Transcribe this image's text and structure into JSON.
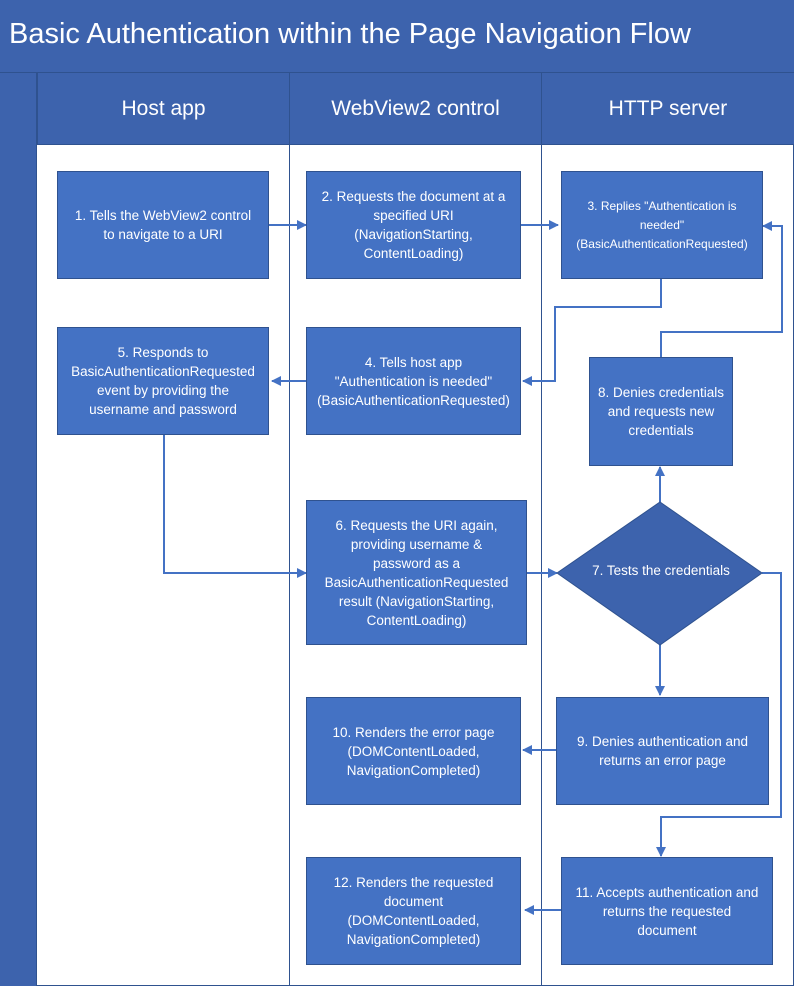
{
  "title": "Basic Authentication within the Page Navigation Flow",
  "lanes": [
    "Host app",
    "WebView2 control",
    "HTTP server"
  ],
  "steps": {
    "s1": "1. Tells the WebView2 control\nto navigate to a URI",
    "s2": "2. Requests the document at a\nspecified URI\n(NavigationStarting,\nContentLoading)",
    "s3": "3. Replies \"Authentication is\nneeded\"\n(BasicAuthenticationRequested)",
    "s4": "4. Tells host app\n\"Authentication is needed\"\n(BasicAuthenticationRequested)",
    "s5": "5. Responds to\nBasicAuthenticationRequested\nevent by providing the\nusername and password",
    "s6": "6. Requests the URI again,\nproviding  username &\npassword as a\nBasicAuthenticationRequested\nresult (NavigationStarting,\nContentLoading)",
    "s7": "7. Tests the credentials",
    "s8": "8. Denies credentials\nand requests new\ncredentials",
    "s9": "9. Denies authentication and\nreturns an error page",
    "s10": "10. Renders the error page\n(DOMContentLoaded,\nNavigationCompleted)",
    "s11": "11. Accepts authentication and\nreturns the requested\ndocument",
    "s12": "12. Renders the requested\ndocument\n(DOMContentLoaded,\nNavigationCompleted)"
  },
  "colors": {
    "header": "#3d63ad",
    "box": "#4472c4",
    "diamond": "#3d63ad",
    "line": "#4472c4",
    "border": "#2f528f"
  }
}
